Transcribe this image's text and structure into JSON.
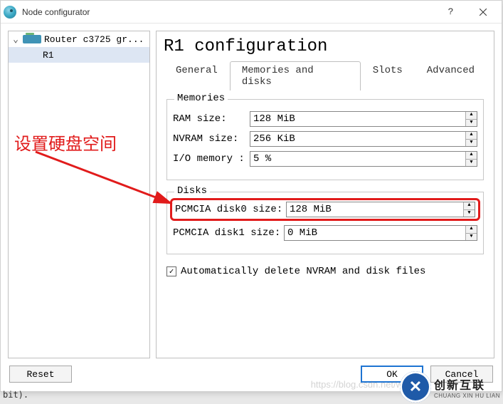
{
  "window": {
    "title": "Node configurator"
  },
  "tree": {
    "root_label": "Router c3725 gr...",
    "child_label": "R1"
  },
  "panel": {
    "title": "R1 configuration"
  },
  "tabs": {
    "general": "General",
    "memdisks": "Memories and disks",
    "slots": "Slots",
    "advanced": "Advanced"
  },
  "memories": {
    "legend": "Memories",
    "ram_label": "RAM size:",
    "ram_value": "128 MiB",
    "nvram_label": "NVRAM size:",
    "nvram_value": "256 KiB",
    "io_label": "I/O memory :",
    "io_value": "5 %"
  },
  "disks": {
    "legend": "Disks",
    "d0_label": "PCMCIA disk0 size:",
    "d0_value": "128 MiB",
    "d1_label": "PCMCIA disk1 size:",
    "d1_value": "0 MiB"
  },
  "auto_delete_label": "Automatically delete NVRAM and disk files",
  "buttons": {
    "reset": "Reset",
    "ok": "OK",
    "cancel": "Cancel"
  },
  "annotation": "设置硬盘空间",
  "watermark": "https://blog.csdn.net/wei...",
  "brand_main": "创新互联",
  "brand_sub": "CHUANG XIN HU LIAN",
  "bottom_fragment": "bit)."
}
